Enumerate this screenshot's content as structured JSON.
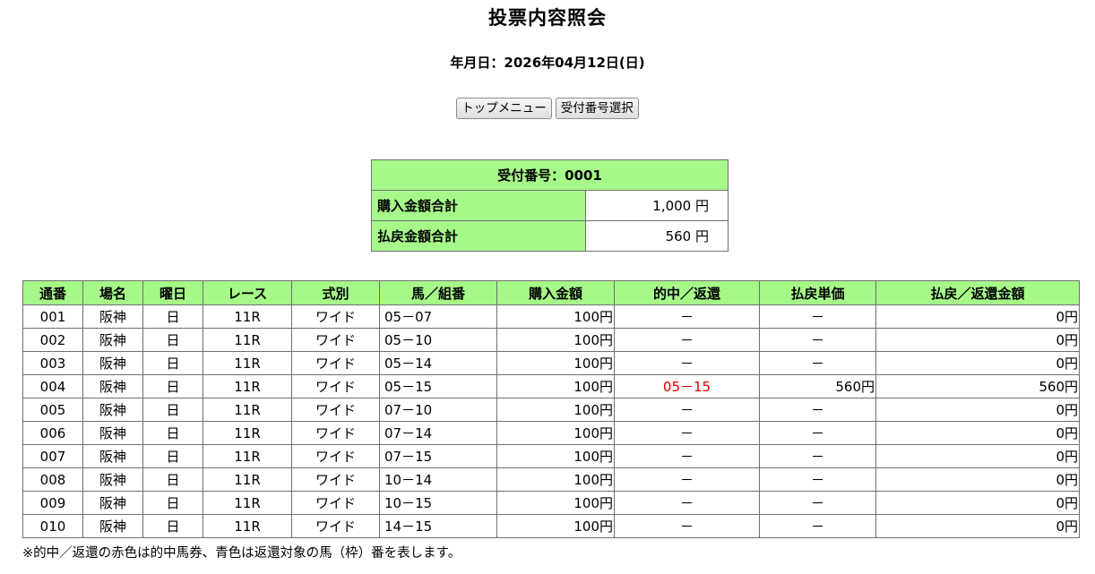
{
  "header": {
    "title": "投票内容照会",
    "date_text": "年月日：2026年04月12日(日)"
  },
  "buttons": {
    "top_menu": "トップメニュー",
    "select_receipt": "受付番号選択"
  },
  "summary": {
    "receipt_label": "受付番号：0001",
    "purchase_total_label": "購入金額合計",
    "purchase_total_value": "1,000 円",
    "payout_total_label": "払戻金額合計",
    "payout_total_value": "560 円"
  },
  "table": {
    "columns": [
      "通番",
      "場名",
      "曜日",
      "レース",
      "式別",
      "馬／組番",
      "購入金額",
      "的中／返還",
      "払戻単価",
      "払戻／返還金額"
    ],
    "rows": [
      {
        "no": "001",
        "venue": "阪神",
        "day": "日",
        "race": "11R",
        "type": "ワイド",
        "combo": "05－07",
        "amount": "100円",
        "hit": "－",
        "unit": "－",
        "payout": "0円",
        "is_hit": false
      },
      {
        "no": "002",
        "venue": "阪神",
        "day": "日",
        "race": "11R",
        "type": "ワイド",
        "combo": "05－10",
        "amount": "100円",
        "hit": "－",
        "unit": "－",
        "payout": "0円",
        "is_hit": false
      },
      {
        "no": "003",
        "venue": "阪神",
        "day": "日",
        "race": "11R",
        "type": "ワイド",
        "combo": "05－14",
        "amount": "100円",
        "hit": "－",
        "unit": "－",
        "payout": "0円",
        "is_hit": false
      },
      {
        "no": "004",
        "venue": "阪神",
        "day": "日",
        "race": "11R",
        "type": "ワイド",
        "combo": "05－15",
        "amount": "100円",
        "hit": "05－15",
        "unit": "560円",
        "payout": "560円",
        "is_hit": true
      },
      {
        "no": "005",
        "venue": "阪神",
        "day": "日",
        "race": "11R",
        "type": "ワイド",
        "combo": "07－10",
        "amount": "100円",
        "hit": "－",
        "unit": "－",
        "payout": "0円",
        "is_hit": false
      },
      {
        "no": "006",
        "venue": "阪神",
        "day": "日",
        "race": "11R",
        "type": "ワイド",
        "combo": "07－14",
        "amount": "100円",
        "hit": "－",
        "unit": "－",
        "payout": "0円",
        "is_hit": false
      },
      {
        "no": "007",
        "venue": "阪神",
        "day": "日",
        "race": "11R",
        "type": "ワイド",
        "combo": "07－15",
        "amount": "100円",
        "hit": "－",
        "unit": "－",
        "payout": "0円",
        "is_hit": false
      },
      {
        "no": "008",
        "venue": "阪神",
        "day": "日",
        "race": "11R",
        "type": "ワイド",
        "combo": "10－14",
        "amount": "100円",
        "hit": "－",
        "unit": "－",
        "payout": "0円",
        "is_hit": false
      },
      {
        "no": "009",
        "venue": "阪神",
        "day": "日",
        "race": "11R",
        "type": "ワイド",
        "combo": "10－15",
        "amount": "100円",
        "hit": "－",
        "unit": "－",
        "payout": "0円",
        "is_hit": false
      },
      {
        "no": "010",
        "venue": "阪神",
        "day": "日",
        "race": "11R",
        "type": "ワイド",
        "combo": "14－15",
        "amount": "100円",
        "hit": "－",
        "unit": "－",
        "payout": "0円",
        "is_hit": false
      }
    ]
  },
  "note": "※的中／返還の赤色は的中馬券、青色は返還対象の馬（枠）番を表します。",
  "colors": {
    "header_bg": "#a6f889",
    "hit_text": "#e00000",
    "border": "#6f6f6f"
  }
}
